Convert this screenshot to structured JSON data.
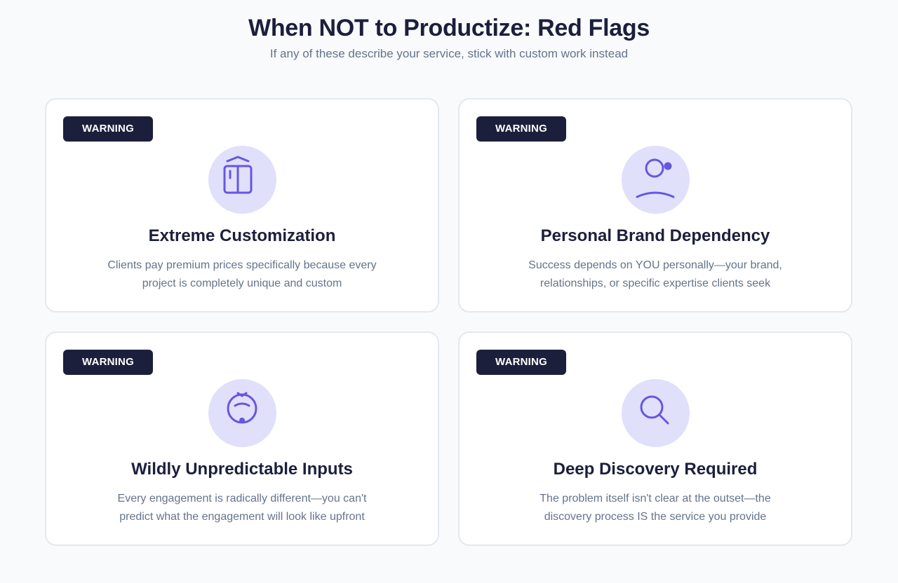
{
  "header": {
    "title": "When NOT to Productize: Red Flags",
    "subtitle": "If any of these describe your service, stick with custom work instead"
  },
  "colors": {
    "badge_bg": "#1c1f3b",
    "icon_circle_bg": "#e0e0fb",
    "icon_stroke": "#6557e0"
  },
  "cards": [
    {
      "badge": "WARNING",
      "icon": "book-icon",
      "title": "Extreme Customization",
      "description": "Clients pay premium prices specifically because every project is completely unique and custom"
    },
    {
      "badge": "WARNING",
      "icon": "user-icon",
      "title": "Personal Brand Dependency",
      "description": "Success depends on YOU personally—your brand, relationships, or specific expertise clients seek"
    },
    {
      "badge": "WARNING",
      "icon": "unpredictable-icon",
      "title": "Wildly Unpredictable Inputs",
      "description": "Every engagement is radically different—you can't predict what the engagement will look like upfront"
    },
    {
      "badge": "WARNING",
      "icon": "search-icon",
      "title": "Deep Discovery Required",
      "description": "The problem itself isn't clear at the outset—the discovery process IS the service you provide"
    }
  ]
}
